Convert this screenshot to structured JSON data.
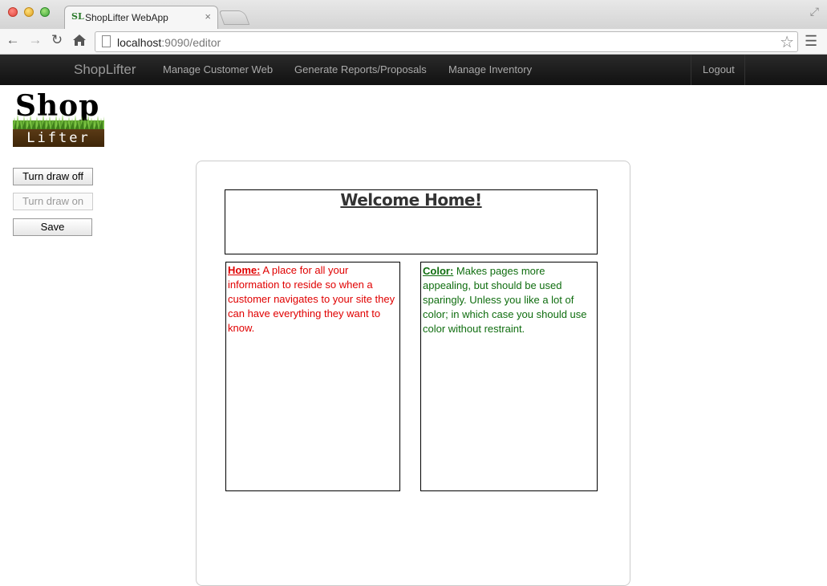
{
  "browser": {
    "tab_title": "ShopLifter WebApp",
    "tab_favicon": "SL",
    "tab_close": "×",
    "url_host": "localhost",
    "url_rest": ":9090/editor"
  },
  "navbar": {
    "brand": "ShopLifter",
    "items": [
      {
        "label": "Manage Customer Web"
      },
      {
        "label": "Generate Reports/Proposals"
      },
      {
        "label": "Manage Inventory"
      }
    ],
    "logout": "Logout"
  },
  "logo": {
    "top_text": "Shop",
    "bottom_text": "Lifter"
  },
  "sidebar": {
    "turn_draw_off": "Turn draw off",
    "turn_draw_on": "Turn draw on",
    "save": "Save"
  },
  "editor": {
    "welcome_title": "Welcome Home!",
    "home_block": {
      "lead": "Home:",
      "text": " A place for all your information to reside so when a customer navigates to your site they can have everything they want to know.",
      "color": "#e00000"
    },
    "color_block": {
      "lead": "Color:",
      "text": " Makes pages more appealing, but should be used sparingly. Unless you like a lot of color; in which case you should use color without restraint.",
      "color": "#0f6d0f"
    }
  },
  "icons": {
    "back": "back-arrow-icon",
    "forward": "forward-arrow-icon",
    "reload": "reload-icon",
    "home": "home-icon",
    "bookmark": "star-icon",
    "menu": "hamburger-menu-icon"
  }
}
